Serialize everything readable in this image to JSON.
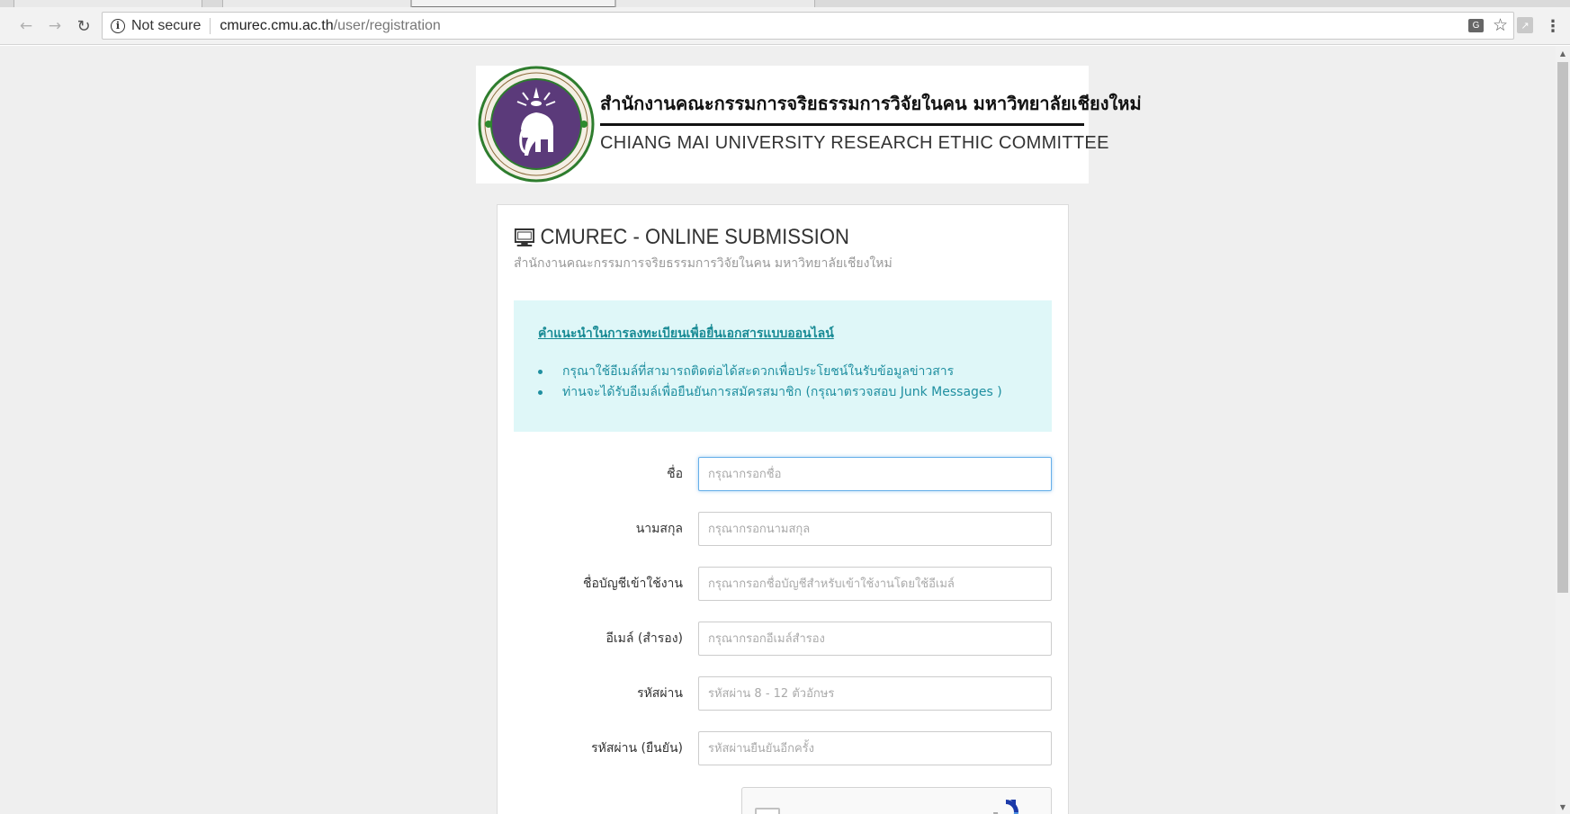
{
  "browser": {
    "security_text": "Not secure",
    "url_host": "cmurec.cmu.ac.th",
    "url_path": "/user/registration"
  },
  "banner": {
    "thai_title": "สำนักงานคณะกรรมการจริยธรรมการวิจัยในคน มหาวิทยาลัยเชียงใหม่",
    "english_title": "CHIANG MAI UNIVERSITY RESEARCH ETHIC COMMITTEE"
  },
  "card": {
    "title": "CMUREC - ONLINE SUBMISSION",
    "subtitle": "สำนักงานคณะกรรมการจริยธรรมการวิจัยในคน มหาวิทยาลัยเชียงใหม่"
  },
  "alert": {
    "heading": "คำแนะนำในการลงทะเบียนเพื่อยื่นเอกสารแบบออนไลน์",
    "items": [
      "กรุณาใช้อีเมล์ที่สามารถติดต่อได้สะดวกเพื่อประโยชน์ในรับข้อมูลข่าวสาร",
      "ท่านจะได้รับอีเมล์เพื่อยืนยันการสมัครสมาชิก (กรุณาตรวจสอบ Junk Messages )"
    ]
  },
  "form": {
    "first_name": {
      "label": "ชื่อ",
      "placeholder": "กรุณากรอกชื่อ"
    },
    "last_name": {
      "label": "นามสกุล",
      "placeholder": "กรุณากรอกนามสกุล"
    },
    "username": {
      "label": "ชื่อบัญชีเข้าใช้งาน",
      "placeholder": "กรุณากรอกชื่อบัญชีสำหรับเข้าใช้งานโดยใช้อีเมล์"
    },
    "alt_email": {
      "label": "อีเมล์ (สำรอง)",
      "placeholder": "กรุณากรอกอีเมล์สำรอง"
    },
    "password": {
      "label": "รหัสผ่าน",
      "placeholder": "รหัสผ่าน 8 - 12 ตัวอักษร"
    },
    "password_confirm": {
      "label": "รหัสผ่าน (ยืนยัน)",
      "placeholder": "รหัสผ่านยืนยันอีกครั้ง"
    }
  },
  "icons": {
    "back": "arrow-left-icon",
    "forward": "arrow-right-icon",
    "reload": "reload-icon",
    "info": "info-icon",
    "translate": "translate-icon",
    "bookmark": "star-icon",
    "extension": "pdf-extension-icon",
    "menu": "kebab-menu-icon",
    "title": "monitor-icon"
  },
  "colors": {
    "alert_bg": "#dff7f8",
    "alert_text": "#1f8fa0",
    "seal_purple": "#5b3a7a",
    "seal_green": "#2e8b2e"
  }
}
